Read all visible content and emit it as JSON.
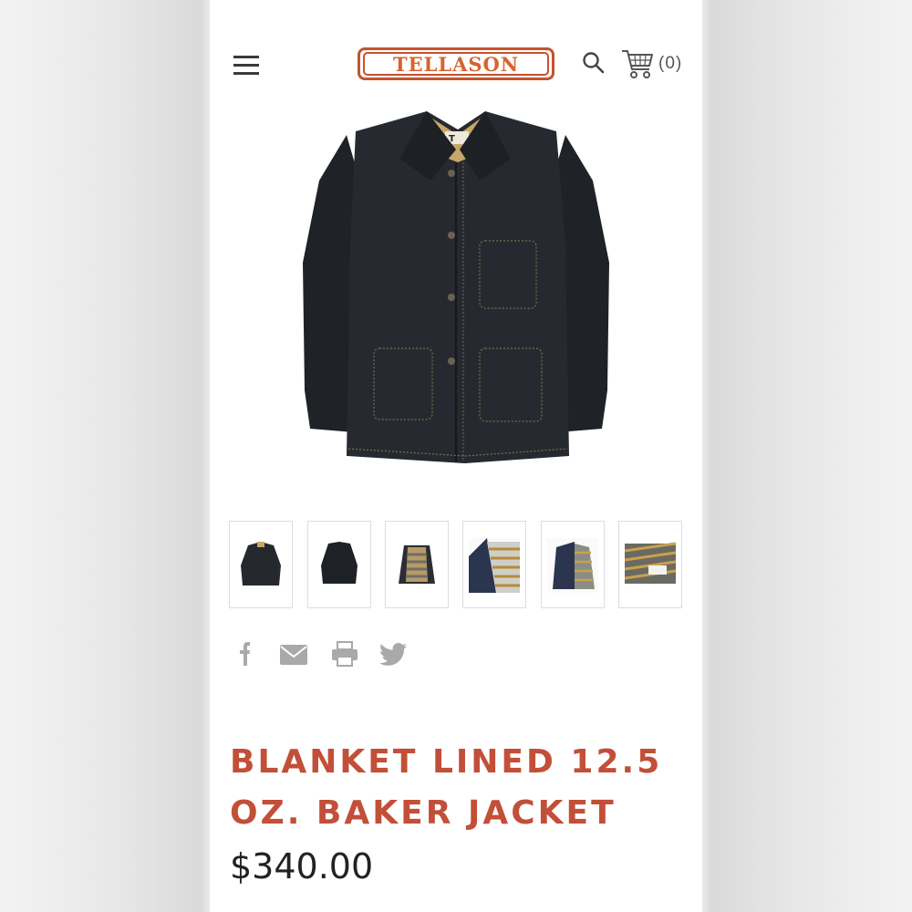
{
  "header": {
    "brand": "TELLASON",
    "cart_count": "(0)",
    "icons": [
      "menu-icon",
      "search-icon",
      "cart-icon"
    ]
  },
  "product": {
    "title": "BLANKET LINED 12.5 OZ. BAKER JACKET",
    "price": "$340.00"
  },
  "gallery": {
    "thumbnail_count": 6,
    "selected_index": 0
  },
  "share": {
    "icons": [
      "facebook-icon",
      "email-icon",
      "print-icon",
      "twitter-icon"
    ]
  },
  "colors": {
    "brand_orange": "#d8622f",
    "title_red": "#c24f38",
    "jacket": "#23262b"
  }
}
